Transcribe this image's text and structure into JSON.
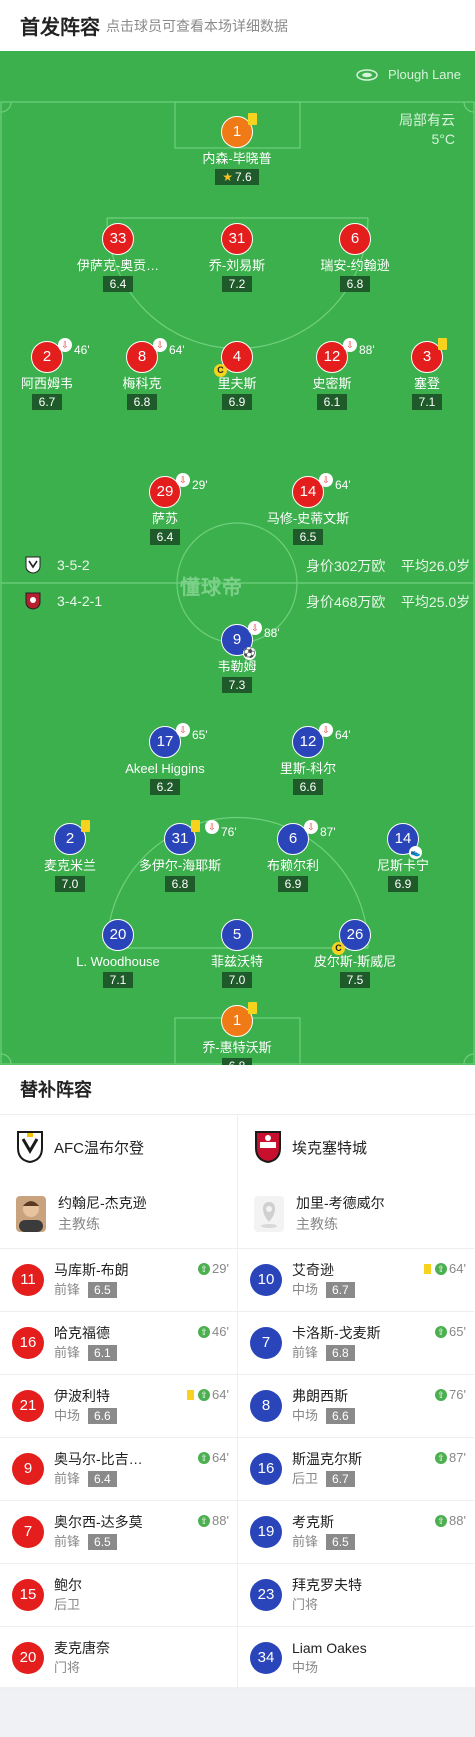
{
  "header": {
    "title": "首发阵容",
    "subtitle": "点击球员可查看本场详细数据"
  },
  "pitch": {
    "venue": "Plough Lane",
    "weather": "局部有云",
    "temperature": "5°C",
    "watermark": "懂球帝",
    "home_formation": "3-5-2",
    "away_formation": "3-4-2-1",
    "home_value": "身价302万欧",
    "home_age": "平均26.0岁",
    "away_value": "身价468万欧",
    "away_age": "平均25.0岁"
  },
  "home_players": [
    {
      "num": "1",
      "name": "内森-毕晓普",
      "rating": "7.6",
      "gk": true,
      "yellow": true,
      "star": true
    },
    {
      "num": "33",
      "name": "伊萨克-奥贡…",
      "rating": "6.4"
    },
    {
      "num": "31",
      "name": "乔-刘易斯",
      "rating": "7.2"
    },
    {
      "num": "6",
      "name": "瑞安-约翰逊",
      "rating": "6.8"
    },
    {
      "num": "2",
      "name": "阿西姆韦",
      "rating": "6.7",
      "sub": "46'"
    },
    {
      "num": "8",
      "name": "梅科克",
      "rating": "6.8",
      "sub": "64'"
    },
    {
      "num": "4",
      "name": "里夫斯",
      "rating": "6.9",
      "captain": true
    },
    {
      "num": "12",
      "name": "史密斯",
      "rating": "6.1",
      "sub": "88'"
    },
    {
      "num": "3",
      "name": "塞登",
      "rating": "7.1",
      "yellow": true
    },
    {
      "num": "29",
      "name": "萨苏",
      "rating": "6.4",
      "sub": "29'"
    },
    {
      "num": "14",
      "name": "马修-史蒂文斯",
      "rating": "6.5",
      "sub": "64'"
    }
  ],
  "away_players": [
    {
      "num": "9",
      "name": "韦勒姆",
      "rating": "7.3",
      "sub": "88'",
      "goal": true
    },
    {
      "num": "17",
      "name": "Akeel Higgins",
      "rating": "6.2",
      "sub": "65'"
    },
    {
      "num": "12",
      "name": "里斯-科尔",
      "rating": "6.6",
      "sub": "64'"
    },
    {
      "num": "2",
      "name": "麦克米兰",
      "rating": "7.0",
      "yellow": true
    },
    {
      "num": "31",
      "name": "多伊尔-海耶斯",
      "rating": "6.8",
      "sub": "76'",
      "yellow": true
    },
    {
      "num": "6",
      "name": "布赖尔利",
      "rating": "6.9",
      "sub": "87'"
    },
    {
      "num": "14",
      "name": "尼斯卡宁",
      "rating": "6.9",
      "boot": true
    },
    {
      "num": "20",
      "name": "L. Woodhouse",
      "rating": "7.1"
    },
    {
      "num": "5",
      "name": "菲兹沃特",
      "rating": "7.0"
    },
    {
      "num": "26",
      "name": "皮尔斯-斯威尼",
      "rating": "7.5",
      "captain": true
    },
    {
      "num": "1",
      "name": "乔-惠特沃斯",
      "rating": "6.8",
      "gk": true,
      "yellow": true
    }
  ],
  "subs": {
    "title": "替补阵容",
    "home": {
      "team": "AFC温布尔登",
      "coach_name": "约翰尼-杰克逊",
      "coach_role": "主教练",
      "players": [
        {
          "num": "11",
          "name": "马库斯-布朗",
          "pos": "前锋",
          "rating": "6.5",
          "time": "29'"
        },
        {
          "num": "16",
          "name": "哈克福德",
          "pos": "前锋",
          "rating": "6.1",
          "time": "46'"
        },
        {
          "num": "21",
          "name": "伊波利特",
          "pos": "中场",
          "rating": "6.6",
          "time": "64'",
          "yellow": true
        },
        {
          "num": "9",
          "name": "奥马尔-比吉…",
          "pos": "前锋",
          "rating": "6.4",
          "time": "64'"
        },
        {
          "num": "7",
          "name": "奥尔西-达多莫",
          "pos": "前锋",
          "rating": "6.5",
          "time": "88'"
        },
        {
          "num": "15",
          "name": "鲍尔",
          "pos": "后卫"
        },
        {
          "num": "20",
          "name": "麦克唐奈",
          "pos": "门将"
        }
      ]
    },
    "away": {
      "team": "埃克塞特城",
      "coach_name": "加里-考德威尔",
      "coach_role": "主教练",
      "players": [
        {
          "num": "10",
          "name": "艾奇逊",
          "pos": "中场",
          "rating": "6.7",
          "time": "64'",
          "yellow": true
        },
        {
          "num": "7",
          "name": "卡洛斯-戈麦斯",
          "pos": "前锋",
          "rating": "6.8",
          "time": "65'"
        },
        {
          "num": "8",
          "name": "弗朗西斯",
          "pos": "中场",
          "rating": "6.6",
          "time": "76'"
        },
        {
          "num": "16",
          "name": "斯温克尔斯",
          "pos": "后卫",
          "rating": "6.7",
          "time": "87'"
        },
        {
          "num": "19",
          "name": "考克斯",
          "pos": "前锋",
          "rating": "6.5",
          "time": "88'"
        },
        {
          "num": "23",
          "name": "拜克罗夫特",
          "pos": "门将"
        },
        {
          "num": "34",
          "name": "Liam Oakes",
          "pos": "中场"
        }
      ]
    }
  },
  "colors": {
    "pitch": "#3cb04d",
    "home": "#e41d1d",
    "away": "#2a45b9",
    "keeper": "#f07a16",
    "yellow_card": "#f7d21f"
  }
}
